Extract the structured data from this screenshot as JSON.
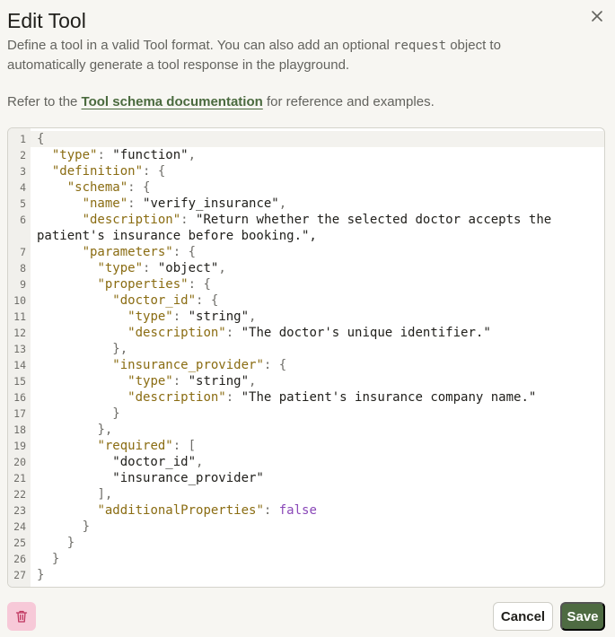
{
  "dialog": {
    "title": "Edit Tool",
    "close_icon": "close-icon",
    "description_before": "Define a tool in a valid Tool format. You can also add an optional ",
    "description_code": "request",
    "description_after": " object to automatically generate a tool response in the playground.",
    "ref_before": "Refer to the ",
    "ref_link": "Tool schema documentation",
    "ref_after": " for reference and examples."
  },
  "editor": {
    "lines": [
      {
        "n": "1",
        "text": "{"
      },
      {
        "n": "2",
        "text": "  \"type\": \"function\","
      },
      {
        "n": "3",
        "text": "  \"definition\": {"
      },
      {
        "n": "4",
        "text": "    \"schema\": {"
      },
      {
        "n": "5",
        "text": "      \"name\": \"verify_insurance\","
      },
      {
        "n": "6",
        "text": "      \"description\": \"Return whether the selected doctor accepts the"
      },
      {
        "n": "",
        "text": "patient's insurance before booking.\","
      },
      {
        "n": "7",
        "text": "      \"parameters\": {"
      },
      {
        "n": "8",
        "text": "        \"type\": \"object\","
      },
      {
        "n": "9",
        "text": "        \"properties\": {"
      },
      {
        "n": "10",
        "text": "          \"doctor_id\": {"
      },
      {
        "n": "11",
        "text": "            \"type\": \"string\","
      },
      {
        "n": "12",
        "text": "            \"description\": \"The doctor's unique identifier.\""
      },
      {
        "n": "13",
        "text": "          },"
      },
      {
        "n": "14",
        "text": "          \"insurance_provider\": {"
      },
      {
        "n": "15",
        "text": "            \"type\": \"string\","
      },
      {
        "n": "16",
        "text": "            \"description\": \"The patient's insurance company name.\""
      },
      {
        "n": "17",
        "text": "          }"
      },
      {
        "n": "18",
        "text": "        },"
      },
      {
        "n": "19",
        "text": "        \"required\": ["
      },
      {
        "n": "20",
        "text": "          \"doctor_id\","
      },
      {
        "n": "21",
        "text": "          \"insurance_provider\""
      },
      {
        "n": "22",
        "text": "        ],"
      },
      {
        "n": "23",
        "text": "        \"additionalProperties\": false"
      },
      {
        "n": "24",
        "text": "      }"
      },
      {
        "n": "25",
        "text": "    }"
      },
      {
        "n": "26",
        "text": "  }"
      },
      {
        "n": "27",
        "text": "}"
      }
    ]
  },
  "footer": {
    "delete_icon": "trash-icon",
    "cancel_label": "Cancel",
    "save_label": "Save"
  },
  "colors": {
    "key": "#8a6c12",
    "boolean": "#8a48b8",
    "primary": "#4e6b42",
    "danger_bg": "#f7c9d8"
  }
}
